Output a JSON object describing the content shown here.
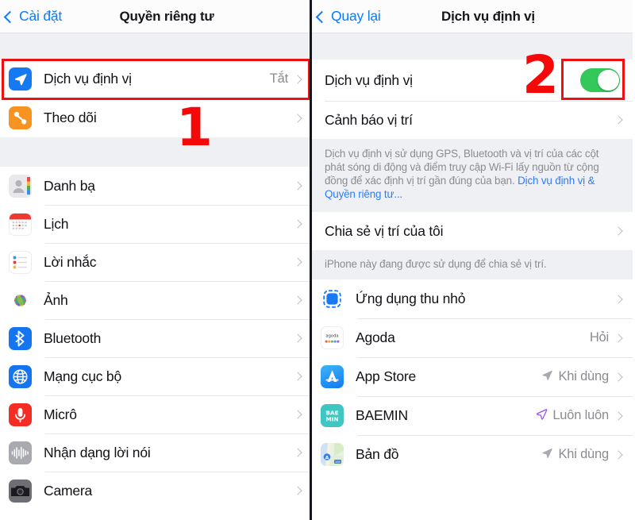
{
  "left": {
    "nav": {
      "back_label": "Cài đặt",
      "title": "Quyền riêng tư",
      "back_icon": "chevron-left-icon"
    },
    "group1": [
      {
        "label": "Dịch vụ định vị",
        "value": "Tắt",
        "icon": "location-services-icon"
      },
      {
        "label": "Theo dõi",
        "value": "",
        "icon": "tracking-icon"
      }
    ],
    "group2": [
      {
        "label": "Danh bạ",
        "value": "",
        "icon": "contacts-icon"
      },
      {
        "label": "Lịch",
        "value": "",
        "icon": "calendar-icon"
      },
      {
        "label": "Lời nhắc",
        "value": "",
        "icon": "reminders-icon"
      },
      {
        "label": "Ảnh",
        "value": "",
        "icon": "photos-icon"
      },
      {
        "label": "Bluetooth",
        "value": "",
        "icon": "bluetooth-icon"
      },
      {
        "label": "Mạng cục bộ",
        "value": "",
        "icon": "local-network-icon"
      },
      {
        "label": "Micrô",
        "value": "",
        "icon": "microphone-icon"
      },
      {
        "label": "Nhận dạng lời nói",
        "value": "",
        "icon": "speech-recognition-icon"
      },
      {
        "label": "Camera",
        "value": "",
        "icon": "camera-icon"
      }
    ],
    "annotation": {
      "step_number": "1"
    }
  },
  "right": {
    "nav": {
      "back_label": "Quay lại",
      "title": "Dịch vụ định vị",
      "back_icon": "chevron-left-icon"
    },
    "group1": [
      {
        "label": "Dịch vụ định vị",
        "control": "toggle",
        "toggle_on": true
      },
      {
        "label": "Cảnh báo vị trí",
        "control": "chevron"
      }
    ],
    "note1_text": "Dịch vụ định vị sử dụng GPS, Bluetooth và vị trí của các cột phát sóng di động và điểm truy cập Wi-Fi lấy nguồn từ cộng đồng để xác định vị trí gần đúng của bạn. ",
    "note1_link": "Dịch vụ định vị & Quyền riêng tư...",
    "group2": [
      {
        "label": "Chia sẻ vị trí của tôi",
        "control": "chevron"
      }
    ],
    "note2_text": "iPhone này đang được sử dụng để chia sẻ vị trí.",
    "apps": [
      {
        "label": "Ứng dụng thu nhỏ",
        "value": "",
        "status_icon": "",
        "icon": "app-clips-icon"
      },
      {
        "label": "Agoda",
        "value": "Hỏi",
        "status_icon": "",
        "icon": "agoda-icon"
      },
      {
        "label": "App Store",
        "value": "Khi dùng",
        "status_icon": "location-arrow-gray-icon",
        "icon": "app-store-icon"
      },
      {
        "label": "BAEMIN",
        "value": "Luôn luôn",
        "status_icon": "location-arrow-purple-icon",
        "icon": "baemin-icon"
      },
      {
        "label": "Bản đồ",
        "value": "Khi dùng",
        "status_icon": "location-arrow-gray-icon",
        "icon": "maps-icon"
      }
    ],
    "annotation": {
      "step_number": "2"
    }
  },
  "colors": {
    "accent_blue": "#0a7cff",
    "toggle_green": "#34c759",
    "annotation_red": "#ee1111",
    "group_bg": "#eff0f4"
  }
}
